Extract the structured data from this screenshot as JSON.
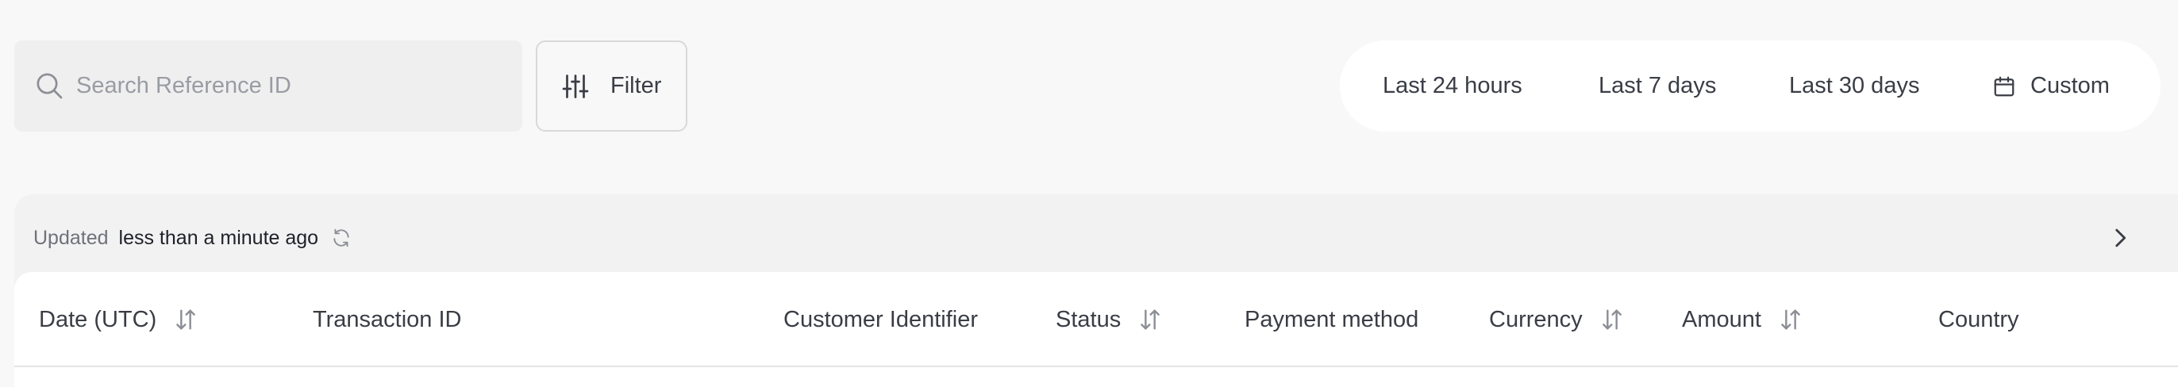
{
  "search": {
    "placeholder": "Search Reference ID",
    "value": "",
    "icon": "search-icon"
  },
  "filter": {
    "label": "Filter",
    "icon": "sliders-icon"
  },
  "time_ranges": [
    {
      "label": "Last 24 hours"
    },
    {
      "label": "Last 7 days"
    },
    {
      "label": "Last 30 days"
    },
    {
      "label": "Custom",
      "icon": "calendar-icon"
    }
  ],
  "status_bar": {
    "updated_label": "Updated",
    "updated_value": "less than a minute ago",
    "refresh_icon": "refresh-icon",
    "expand_icon": "chevron-right-icon"
  },
  "table": {
    "columns": [
      {
        "label": "Date (UTC)",
        "sortable": true
      },
      {
        "label": "Transaction ID",
        "sortable": false
      },
      {
        "label": "Customer Identifier",
        "sortable": false
      },
      {
        "label": "Status",
        "sortable": true
      },
      {
        "label": "Payment method",
        "sortable": false
      },
      {
        "label": "Currency",
        "sortable": true
      },
      {
        "label": "Amount",
        "sortable": true
      },
      {
        "label": "Country",
        "sortable": false
      }
    ],
    "rows": []
  },
  "colors": {
    "page_bg": "#f8f8f8",
    "text": "#3a3d45",
    "muted": "#9a9ca3",
    "panel_bg": "#f2f2f3",
    "card_bg": "#ffffff"
  }
}
